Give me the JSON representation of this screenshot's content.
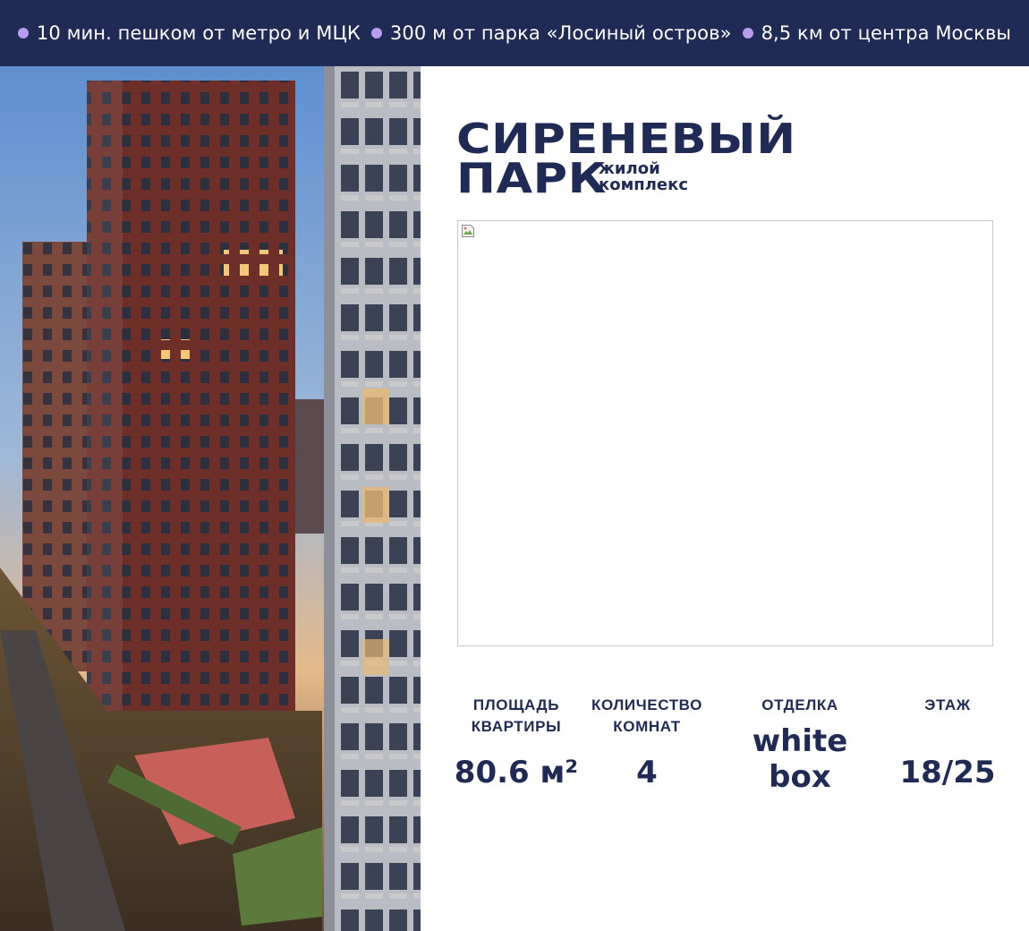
{
  "features": [
    {
      "text": "10 мин. пешком от метро и МЦК"
    },
    {
      "text": "300 м от парка «Лосиный остров»"
    },
    {
      "text": "8,5 км от центра Москвы"
    }
  ],
  "logo": {
    "line1": "СИРЕНЕВЫЙ",
    "line2": "ПАРК",
    "sub1": "жилой",
    "sub2": "комплекс"
  },
  "stats": [
    {
      "label": "ПЛОЩАДЬ\nКВАРТИРЫ",
      "value": "80.6 м²"
    },
    {
      "label": "КОЛИЧЕСТВО\nКОМНАТ",
      "value": "4"
    },
    {
      "label": "ОТДЕЛКА",
      "value": "white\nbox"
    },
    {
      "label": "ЭТАЖ",
      "value": "18/25"
    }
  ],
  "colors": {
    "brand_navy": "#1f2a55",
    "accent_lilac": "#b79cf0"
  }
}
